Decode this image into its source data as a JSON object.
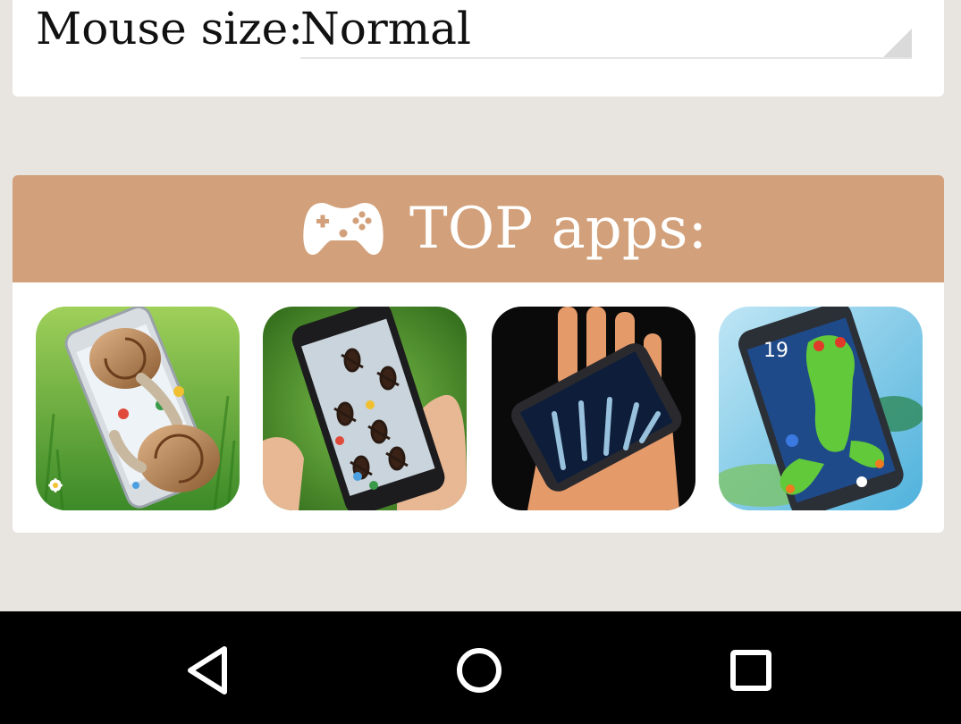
{
  "settings": {
    "mouse_size_label": "Mouse size:",
    "mouse_size_value": "Normal"
  },
  "top_apps": {
    "title": "TOP apps:",
    "header_color": "#d2a07a",
    "icon": "gamepad-icon",
    "apps": [
      {
        "icon": "snails-on-phone-icon"
      },
      {
        "icon": "ants-on-phone-icon"
      },
      {
        "icon": "xray-hand-icon"
      },
      {
        "icon": "frog-on-phone-icon"
      }
    ]
  },
  "navigation": {
    "back": "back-icon",
    "home": "home-icon",
    "recents": "recents-icon"
  }
}
